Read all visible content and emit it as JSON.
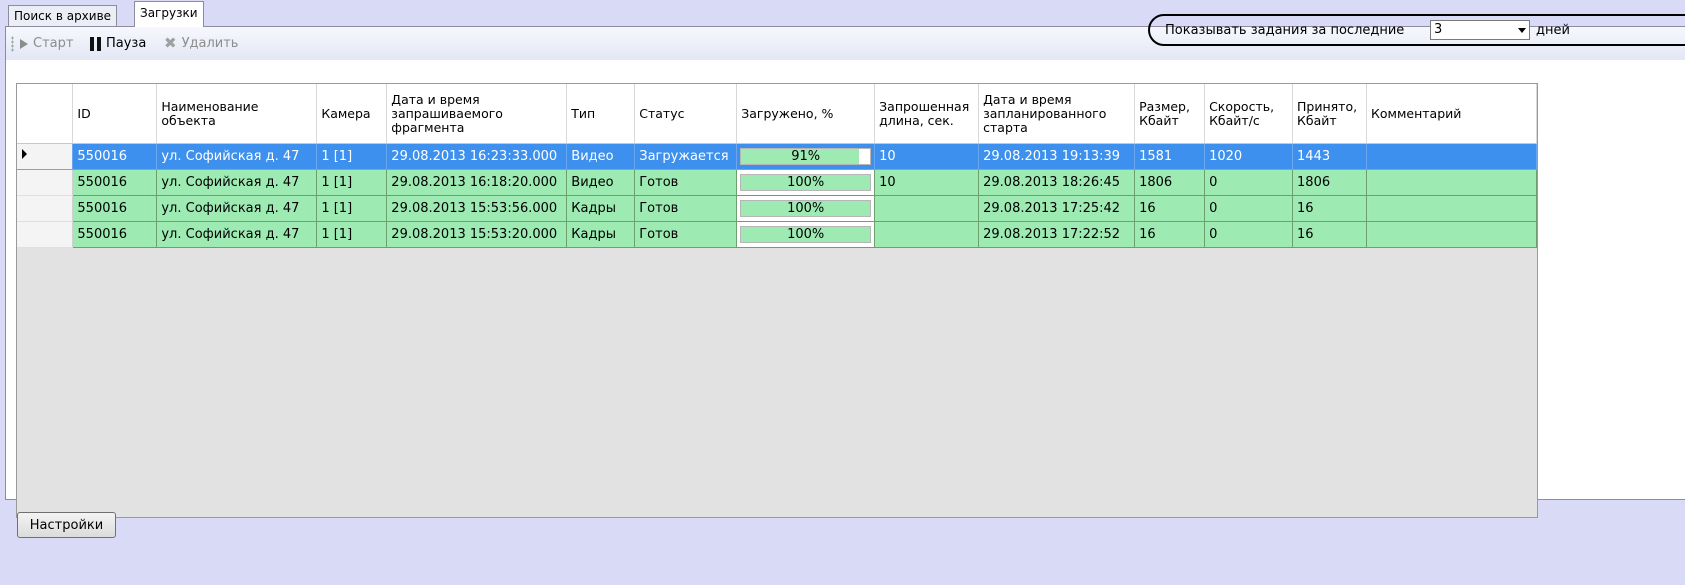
{
  "tabs": [
    {
      "label": "Поиск в архиве",
      "active": false
    },
    {
      "label": "Загрузки",
      "active": true
    }
  ],
  "toolbar": {
    "start_label": "Старт",
    "pause_label": "Пауза",
    "delete_label": "Удалить",
    "filter_label": "Показывать задания за последние",
    "filter_value": "3",
    "filter_unit": "дней"
  },
  "grid": {
    "columns": [
      "ID",
      "Наименование объекта",
      "Камера",
      "Дата и время запрашиваемого фрагмента",
      "Тип",
      "Статус",
      "Загружено, %",
      "Запрошенная длина, сек.",
      "Дата и время запланированного старта",
      "Размер, Кбайт",
      "Скорость, Кбайт/с",
      "Принято, Кбайт",
      "Комментарий"
    ],
    "rows": [
      {
        "id": "550016",
        "object": "ул. Софийская д. 47",
        "camera": "1 [1]",
        "fragment_time": "29.08.2013 16:23:33.000",
        "type": "Видео",
        "status": "Загружается",
        "progress_label": "91%",
        "progress": 0.91,
        "length": "10",
        "start_time": "29.08.2013 19:13:39",
        "size": "1581",
        "speed": "1020",
        "received": "1443",
        "comment": "",
        "selected": true
      },
      {
        "id": "550016",
        "object": "ул. Софийская д. 47",
        "camera": "1 [1]",
        "fragment_time": "29.08.2013 16:18:20.000",
        "type": "Видео",
        "status": "Готов",
        "progress_label": "100%",
        "progress": 1.0,
        "length": "10",
        "start_time": "29.08.2013 18:26:45",
        "size": "1806",
        "speed": "0",
        "received": "1806",
        "comment": "",
        "selected": false
      },
      {
        "id": "550016",
        "object": "ул. Софийская д. 47",
        "camera": "1 [1]",
        "fragment_time": "29.08.2013 15:53:56.000",
        "type": "Кадры",
        "status": "Готов",
        "progress_label": "100%",
        "progress": 1.0,
        "length": "",
        "start_time": "29.08.2013 17:25:42",
        "size": "16",
        "speed": "0",
        "received": "16",
        "comment": "",
        "selected": false
      },
      {
        "id": "550016",
        "object": "ул. Софийская д. 47",
        "camera": "1 [1]",
        "fragment_time": "29.08.2013 15:53:20.000",
        "type": "Кадры",
        "status": "Готов",
        "progress_label": "100%",
        "progress": 1.0,
        "length": "",
        "start_time": "29.08.2013 17:22:52",
        "size": "16",
        "speed": "0",
        "received": "16",
        "comment": "",
        "selected": false
      }
    ]
  },
  "footer": {
    "settings_label": "Настройки"
  },
  "colors": {
    "background": "#d8daf6",
    "row_done": "#9deab3",
    "row_selected": "#3d90ee"
  }
}
